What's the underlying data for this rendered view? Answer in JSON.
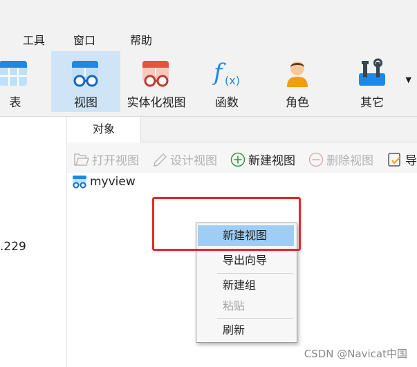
{
  "menu": [
    "工具",
    "窗口",
    "帮助"
  ],
  "toolbar": {
    "items": [
      {
        "label": "表",
        "icon": "table-icon"
      },
      {
        "label": "视图",
        "icon": "view-icon",
        "active": true
      },
      {
        "label": "实体化视图",
        "icon": "materialized-view-icon"
      },
      {
        "label": "函数",
        "icon": "function-icon"
      },
      {
        "label": "角色",
        "icon": "role-icon"
      },
      {
        "label": "其它",
        "icon": "others-icon"
      }
    ],
    "overflow_icon": "chevron-down-icon"
  },
  "connection": {
    "host_fragment": ".229"
  },
  "tabs": [
    {
      "label": "对象"
    }
  ],
  "object_toolbar": {
    "open_view": "打开视图",
    "design_view": "设计视图",
    "new_view": "新建视图",
    "delete_view": "删除视图",
    "export": "导"
  },
  "objects": [
    {
      "name": "myview",
      "icon": "view-icon"
    }
  ],
  "context_menu": {
    "items": [
      "新建视图",
      "导出向导",
      "新建组",
      "粘贴",
      "刷新"
    ],
    "highlighted": "新建视图",
    "disabled": [
      "粘贴"
    ]
  },
  "annotation": {
    "color": "#e8262b"
  },
  "watermark": "CSDN @Navicat中国",
  "colors": {
    "accent_blue": "#1e88e5",
    "active_tool_bg": "#cfe5f7",
    "menu_highlight": "#9fcdf3",
    "new_view_green": "#2e9b3b"
  }
}
